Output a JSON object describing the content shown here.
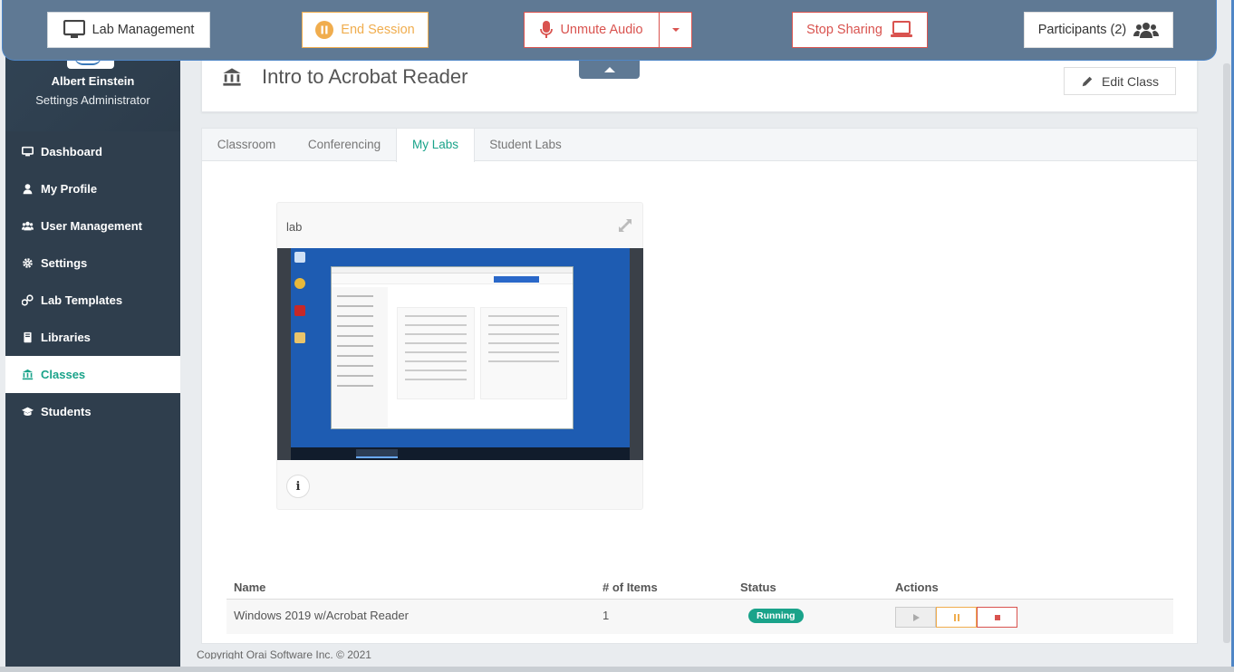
{
  "toolbar": {
    "lab_management": "Lab Management",
    "end_session": "End Session",
    "unmute_audio": "Unmute Audio",
    "stop_sharing": "Stop Sharing",
    "participants": "Participants (2)"
  },
  "profile": {
    "name": "Albert Einstein",
    "role": "Settings Administrator"
  },
  "sidebar": {
    "items": [
      {
        "label": "Dashboard",
        "icon": "monitor-icon"
      },
      {
        "label": "My Profile",
        "icon": "user-icon"
      },
      {
        "label": "User Management",
        "icon": "users-icon"
      },
      {
        "label": "Settings",
        "icon": "gear-icon"
      },
      {
        "label": "Lab Templates",
        "icon": "flask-icon"
      },
      {
        "label": "Libraries",
        "icon": "book-icon"
      },
      {
        "label": "Classes",
        "icon": "institution-icon",
        "active": true
      },
      {
        "label": "Students",
        "icon": "graduation-cap-icon"
      }
    ]
  },
  "class": {
    "title": "Intro to Acrobat Reader",
    "edit_label": "Edit Class"
  },
  "tabs": [
    "Classroom",
    "Conferencing",
    "My Labs",
    "Student Labs"
  ],
  "active_tab": "My Labs",
  "lab_card": {
    "name": "lab"
  },
  "table": {
    "headers": [
      "Name",
      "# of Items",
      "Status",
      "Actions"
    ],
    "rows": [
      {
        "name": "Windows 2019 w/Acrobat Reader",
        "items": "1",
        "status": "Running"
      }
    ]
  },
  "footer": {
    "text": "Copyright Orai Software Inc. © 2021"
  },
  "colors": {
    "accent": "#1aa38a",
    "sidebar": "#2f3e4d",
    "toolbar": "#5f7994",
    "warning": "#f0ad4e",
    "danger": "#d9534f"
  }
}
